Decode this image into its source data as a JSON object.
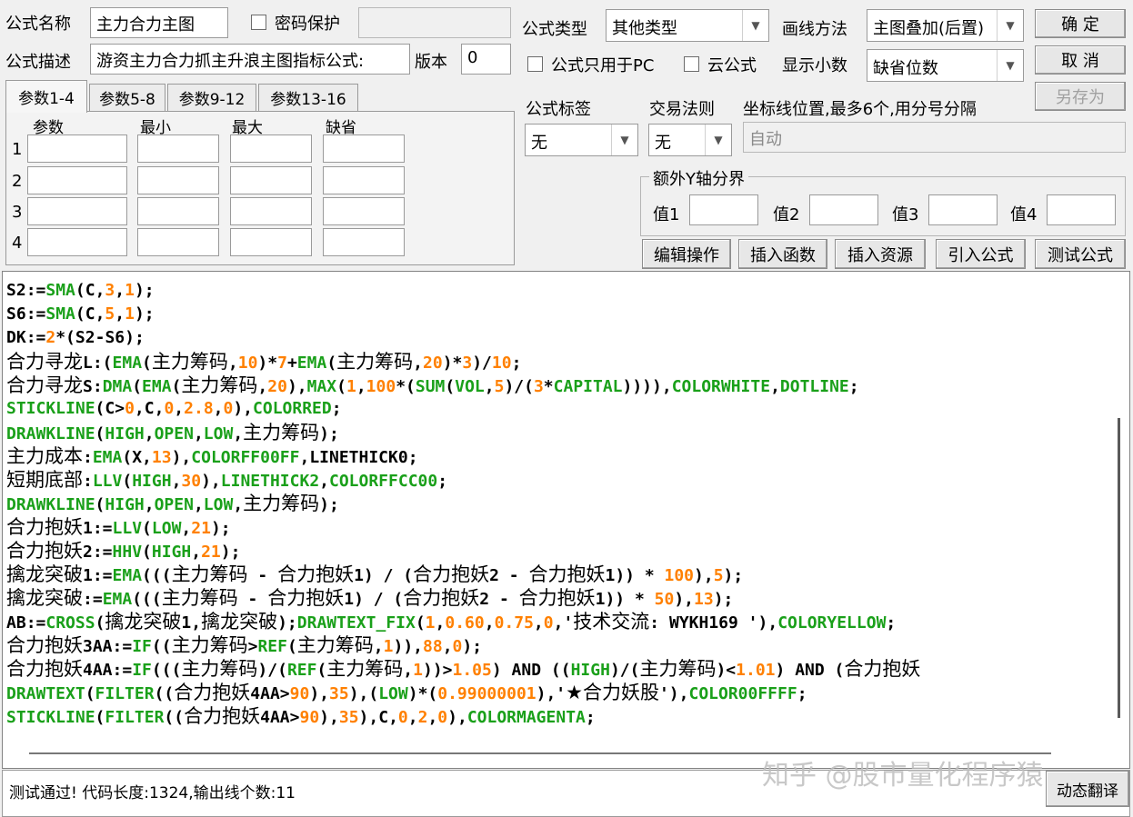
{
  "form": {
    "name_label": "公式名称",
    "name_value": "主力合力主图",
    "password_label": "密码保护",
    "desc_label": "公式描述",
    "desc_value": "游资主力合力抓主升浪主图指标公式:",
    "version_label": "版本",
    "version_value": "0",
    "type_label": "公式类型",
    "type_value": "其他类型",
    "draw_label": "画线方法",
    "draw_value": "主图叠加(后置)",
    "pc_only_label": "公式只用于PC",
    "cloud_label": "云公式",
    "decimals_label": "显示小数",
    "decimals_value": "缺省位数",
    "tag_label": "公式标签",
    "tag_value": "无",
    "trade_label": "交易法则",
    "trade_value": "无",
    "coord_label": "坐标线位置,最多6个,用分号分隔",
    "coord_value": "自动",
    "extra_y_title": "额外Y轴分界",
    "v1": "值1",
    "v2": "值2",
    "v3": "值3",
    "v4": "值4"
  },
  "buttons": {
    "ok": "确  定",
    "cancel": "取  消",
    "save_as": "另存为",
    "edit": "编辑操作",
    "insert_func": "插入函数",
    "insert_res": "插入资源",
    "import": "引入公式",
    "test": "测试公式",
    "translate": "动态翻译"
  },
  "params": {
    "tabs": [
      "参数1-4",
      "参数5-8",
      "参数9-12",
      "参数13-16"
    ],
    "headers": [
      "参数",
      "最小",
      "最大",
      "缺省"
    ],
    "rows": [
      "1",
      "2",
      "3",
      "4"
    ]
  },
  "code_lines": [
    "S2:=SMA(C,3,1);",
    "S6:=SMA(C,5,1);",
    "DK:=2*(S2-S6);",
    "合力寻龙L:(EMA(主力筹码,10)*7+EMA(主力筹码,20)*3)/10;",
    "合力寻龙S:DMA(EMA(主力筹码,20),MAX(1,100*(SUM(VOL,5)/(3*CAPITAL)))),COLORWHITE,DOTLINE;",
    "STICKLINE(C>0,C,0,2.8,0),COLORRED;",
    "DRAWKLINE(HIGH,OPEN,LOW,主力筹码);",
    "主力成本:EMA(X,13),COLORFF00FF,LINETHICK0;",
    "短期底部:LLV(HIGH,30),LINETHICK2,COLORFFCC00;",
    "DRAWKLINE(HIGH,OPEN,LOW,主力筹码);",
    "合力抱妖1:=LLV(LOW,21);",
    "合力抱妖2:=HHV(HIGH,21);",
    "擒龙突破1:=EMA(((主力筹码 - 合力抱妖1) / (合力抱妖2 - 合力抱妖1)) * 100),5);",
    "擒龙突破:=EMA(((主力筹码 - 合力抱妖1) / (合力抱妖2 - 合力抱妖1)) * 50),13);",
    "AB:=CROSS(擒龙突破1,擒龙突破);DRAWTEXT_FIX(1,0.60,0.75,0,'技术交流: WYKH169 '),COLORYELLOW;",
    "合力抱妖3AA:=IF((主力筹码>REF(主力筹码,1)),88,0);",
    "合力抱妖4AA:=IF(((主力筹码)/(REF(主力筹码,1))>1.05) AND ((HIGH)/(主力筹码)<1.01) AND (合力抱妖",
    "DRAWTEXT(FILTER((合力抱妖4AA>90),35),(LOW)*(0.99000001),'★合力妖股'),COLOR00FFFF;",
    "STICKLINE(FILTER((合力抱妖4AA>90),35),C,0,2,0),COLORMAGENTA;"
  ],
  "status_text": "测试通过! 代码长度:1324,输出线个数:11",
  "watermark": "知乎 @股市量化程序猿"
}
